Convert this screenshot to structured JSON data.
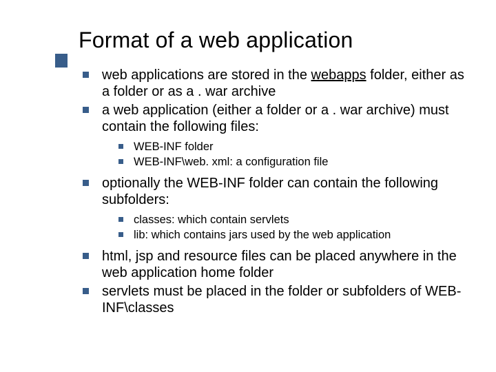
{
  "title": "Format of a web application",
  "bullets": {
    "b1_pre": "web applications are stored in the ",
    "b1_underlined": "webapps",
    "b1_post": " folder, either as a folder or as a . war archive",
    "b2": "a web application (either a folder or a . war archive) must contain the following files:",
    "b2_sub1": "WEB-INF folder",
    "b2_sub2": "WEB-INF\\web. xml: a configuration file",
    "b3": "optionally the WEB-INF folder can contain the following subfolders:",
    "b3_sub1": "classes: which contain servlets",
    "b3_sub2": "lib: which contains jars used by the web application",
    "b4": "html, jsp and resource files can be placed anywhere in the web application home folder",
    "b5": "servlets must be placed in the folder or subfolders of WEB-INF\\classes"
  }
}
